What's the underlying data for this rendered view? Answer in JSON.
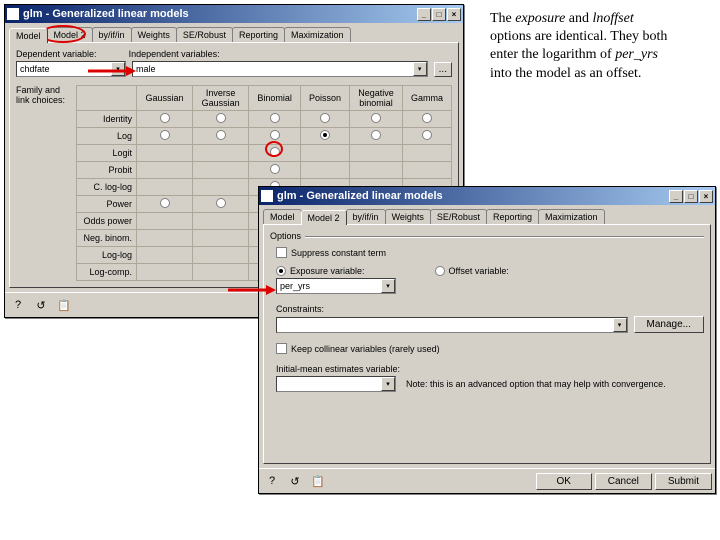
{
  "window1": {
    "title": "glm - Generalized linear models",
    "tabs": [
      "Model",
      "Model 2",
      "by/if/in",
      "Weights",
      "SE/Robust",
      "Reporting",
      "Maximization"
    ],
    "active_tab": 1,
    "dep_label": "Dependent variable:",
    "dep_value": "chdfate",
    "indep_label": "Independent variables:",
    "indep_value": "male",
    "ellipsis": "...",
    "family_label": "Family and\nlink choices:",
    "col_headers": [
      "",
      "Gaussian",
      "Inverse\nGaussian",
      "Binomial",
      "Poisson",
      "Negative\nbinomial",
      "Gamma"
    ],
    "row_labels": [
      "Identity",
      "Log",
      "Logit",
      "Probit",
      "C. log-log",
      "Power",
      "Odds power",
      "Neg. binom.",
      "Log-log",
      "Log-comp."
    ]
  },
  "window2": {
    "title": "glm - Generalized linear models",
    "tabs": [
      "Model",
      "Model 2",
      "by/if/in",
      "Weights",
      "SE/Robust",
      "Reporting",
      "Maximization"
    ],
    "active_tab": 1,
    "options_label": "Options",
    "suppress_label": "Suppress constant term",
    "exposure_label": "Exposure variable:",
    "offset_label": "Offset variable:",
    "exposure_value": "per_yrs",
    "constraints_label": "Constraints:",
    "manage_label": "Manage...",
    "keep_label": "Keep collinear variables (rarely used)",
    "initmean_label": "Initial-mean estimates variable:",
    "note": "Note: this is an advanced option that may help with convergence.",
    "ok": "OK",
    "cancel": "Cancel",
    "submit": "Submit"
  },
  "annotation": {
    "line1a": "The ",
    "line1b": "exposure",
    "line1c": " and ",
    "line1d": "lnoffset",
    "line2": "options are identical.  They both",
    "line3a": "enter the logarithm of ",
    "line3b": "per_yrs",
    "line4": "into the model as an offset."
  },
  "footer_icons": {
    "help": "?",
    "reset": "R",
    "copy": "📋"
  }
}
